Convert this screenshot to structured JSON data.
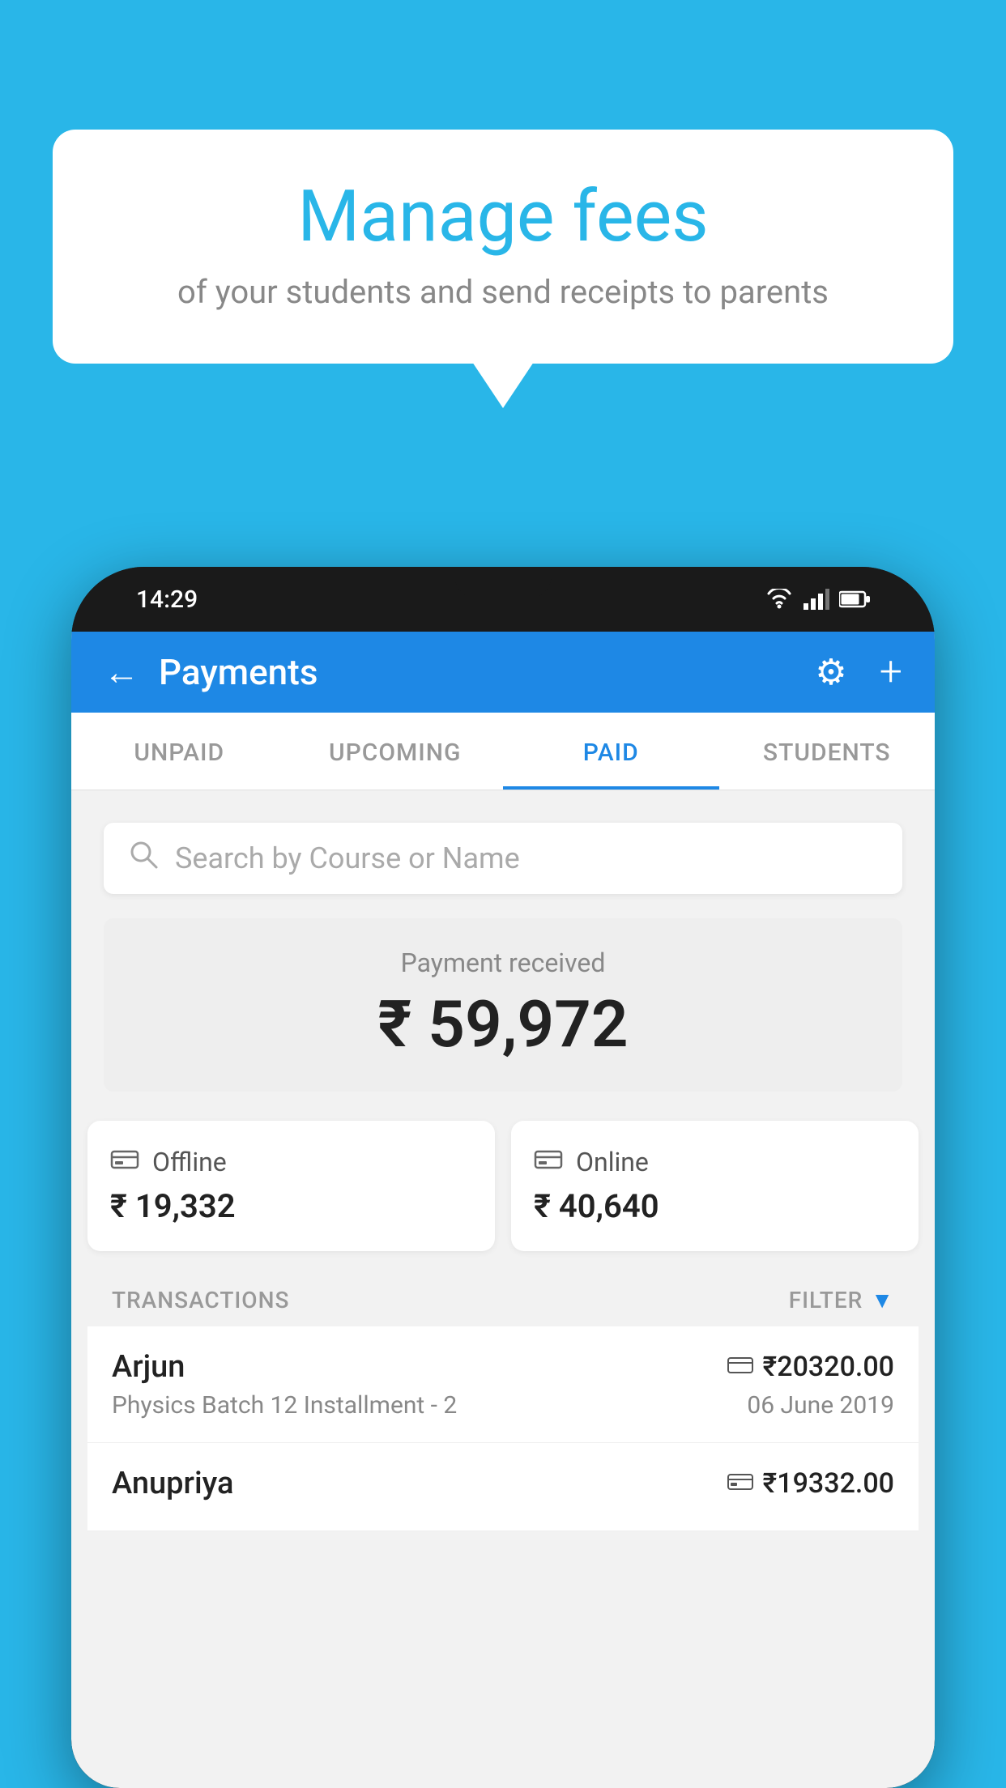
{
  "background_color": "#29b6e8",
  "speech_bubble": {
    "title": "Manage fees",
    "subtitle": "of your students and send receipts to parents"
  },
  "phone": {
    "status_bar": {
      "time": "14:29"
    },
    "header": {
      "title": "Payments",
      "back_label": "←",
      "gear_symbol": "⚙",
      "plus_symbol": "+"
    },
    "tabs": [
      {
        "label": "UNPAID",
        "active": false
      },
      {
        "label": "UPCOMING",
        "active": false
      },
      {
        "label": "PAID",
        "active": true
      },
      {
        "label": "STUDENTS",
        "active": false
      }
    ],
    "search": {
      "placeholder": "Search by Course or Name"
    },
    "payment_summary": {
      "label": "Payment received",
      "amount": "₹ 59,972"
    },
    "payment_cards": [
      {
        "type": "Offline",
        "amount": "₹ 19,332",
        "icon": "💳"
      },
      {
        "type": "Online",
        "amount": "₹ 40,640",
        "icon": "💳"
      }
    ],
    "transactions_label": "TRANSACTIONS",
    "filter_label": "FILTER",
    "transactions": [
      {
        "name": "Arjun",
        "course": "Physics Batch 12 Installment - 2",
        "amount": "₹20320.00",
        "date": "06 June 2019",
        "payment_type": "online"
      },
      {
        "name": "Anupriya",
        "course": "",
        "amount": "₹19332.00",
        "date": "",
        "payment_type": "offline"
      }
    ]
  }
}
